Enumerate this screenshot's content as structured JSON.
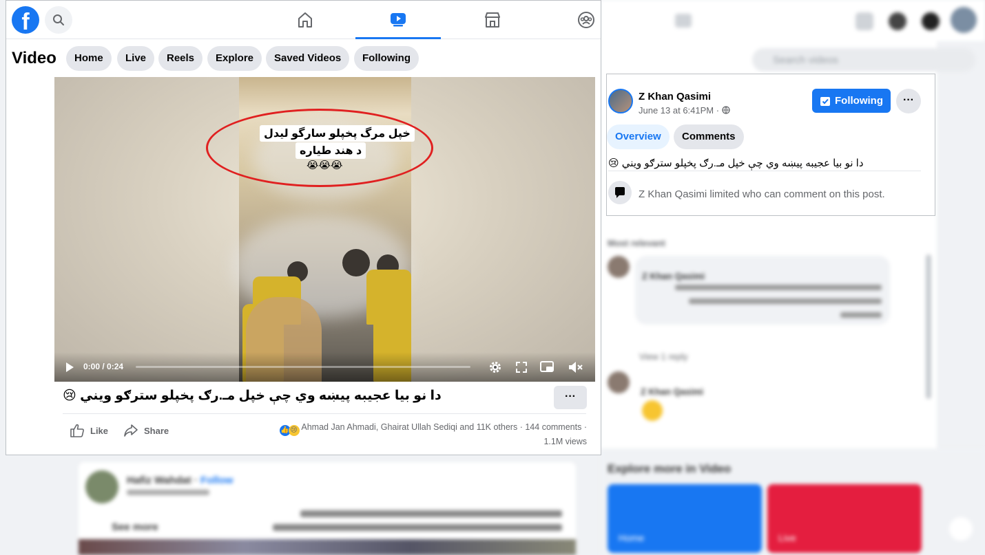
{
  "nav": {
    "logo": "f",
    "tabs": [
      "home",
      "video",
      "marketplace",
      "groups"
    ]
  },
  "video_header": {
    "title": "Video",
    "pills": [
      "Home",
      "Live",
      "Reels",
      "Explore",
      "Saved Videos",
      "Following"
    ]
  },
  "player": {
    "caption_line1": "خپل مرگ پخپلو سارگو لیدل",
    "caption_line2": "د هند طیاره",
    "caption_emoji": "😭😭😭",
    "time": "0:00 / 0:24",
    "progress": 0.0
  },
  "post": {
    "title": "دا نو بیا عجیبه پیښه وي چې خپل مـ.رګ پخپلو سترګو ویني 😢",
    "more": "···",
    "like_label": "Like",
    "share_label": "Share",
    "reaction_names": "Ahmad Jan Ahmadi, Ghairat Ullah Sediqi and 11K others",
    "comments": "144 comments",
    "views": "1.1M views",
    "sep": "·"
  },
  "info": {
    "author": "Z Khan Qasimi",
    "date": "June 13 at 6:41PM · ",
    "follow_label": "Following",
    "more": "···",
    "tabs": [
      "Overview",
      "Comments"
    ],
    "caption": "دا نو بیا عجیبه پیښه وي چې خپل مـ.رګ پخپلو سترګو ویني 😢",
    "limit_text": "Z Khan Qasimi limited who can comment on this post."
  },
  "background": {
    "search_placeholder": "Search videos",
    "most_relevant": "Most relevant",
    "comment_author": "Z Khan Qasimi",
    "view_replies": "View 1 reply",
    "explore_title": "Explore more in Video",
    "card_home": "Home",
    "card_live": "Live",
    "next_author": "Hafiz Wahdat",
    "next_follow": "Follow",
    "see_more": "See more"
  },
  "colors": {
    "brand": "#1877f2",
    "live_red": "#e41e3f"
  }
}
